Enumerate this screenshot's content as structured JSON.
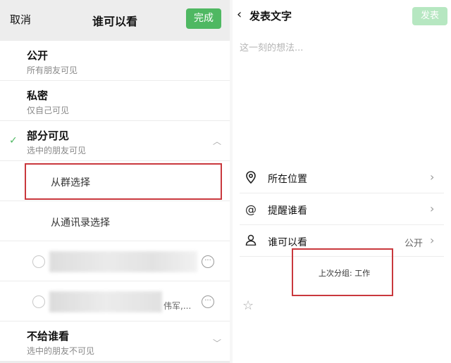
{
  "left": {
    "cancel": "取消",
    "title": "谁可以看",
    "done": "完成",
    "options": [
      {
        "title": "公开",
        "subtitle": "所有朋友可见"
      },
      {
        "title": "私密",
        "subtitle": "仅自己可见"
      },
      {
        "title": "部分可见",
        "subtitle": "选中的朋友可见"
      }
    ],
    "sub_options": [
      "从群选择",
      "从通讯录选择"
    ],
    "member_partial_name": "伟军,...",
    "more_glyph": "···",
    "last_option": {
      "title": "不给谁看",
      "subtitle": "选中的朋友不可见"
    }
  },
  "right": {
    "title": "发表文字",
    "publish": "发表",
    "placeholder": "这一刻的想法...",
    "rows": [
      {
        "label": "所在位置",
        "icon": "location-pin-icon",
        "value": ""
      },
      {
        "label": "提醒谁看",
        "icon": "at-sign-icon",
        "value": ""
      },
      {
        "label": "谁可以看",
        "icon": "person-icon",
        "value": "公开"
      }
    ],
    "last_group": "上次分组: 工作"
  },
  "colors": {
    "accent_green": "#4fb862",
    "highlight_red": "#c9383d",
    "disabled_green": "#b6e7c1"
  }
}
